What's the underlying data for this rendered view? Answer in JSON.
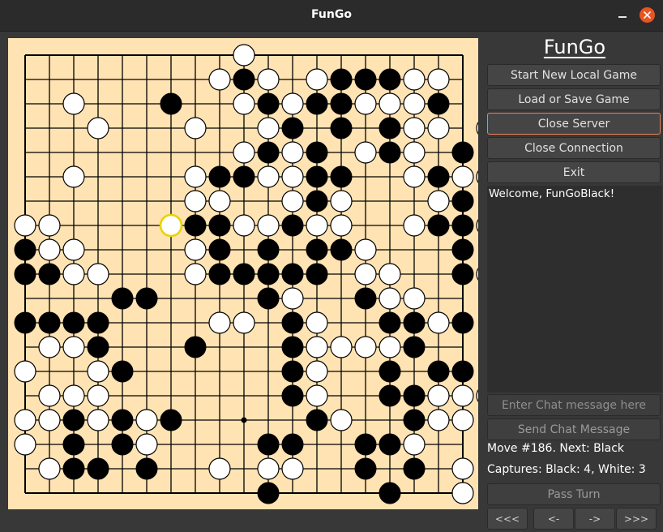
{
  "window": {
    "title": "FunGo"
  },
  "sidebar": {
    "app_title": "FunGo",
    "buttons": {
      "new_local_game": "Start New Local Game",
      "load_save": "Load or Save Game",
      "close_server": "Close Server",
      "close_connection": "Close Connection",
      "exit": "Exit"
    },
    "chat_log": "Welcome, FunGoBlack!",
    "chat_placeholder": "Enter Chat message here",
    "send_chat": "Send Chat Message",
    "move_status": "Move #186. Next: Black",
    "captures": "Captures: Black: 4, White: 3",
    "pass_turn": "Pass Turn",
    "nav": {
      "first": "<<<",
      "prev": "<-",
      "next": "->",
      "last": ">>>"
    }
  },
  "board": {
    "size": 19,
    "colors": {
      "background": "#ffe3b3",
      "line": "#000000",
      "last_move": "#e6d400",
      "black": "#000000",
      "white": "#ffffff"
    },
    "rows": [
      "         W         ",
      "        WBW WBBBWW ",
      "  W   B  WBWBBWWWB ",
      "   W   W  WB B BWW W",
      "         WBWB WBW B",
      "  W    WBBWWBB  WBWWB",
      "       WW  WBW   WB B",
      "WW    *BBWWBWW  WBBW",
      "BWW    WB B BBW   B B",
      "BBWW   WBBBBB WW  BW",
      "    BB    BW  BWW",
      "BBBB    WW BW  BBWB",
      " WWB   B   BWWWWB",
      "W  WB      BW  B BB",
      " WWW       BW  BBWWW",
      "WWBWBWB  .  BW  BWW",
      "W B BW    BB  BBW",
      " WBB B  W WW  B B W",
      "          B    B  W"
    ],
    "last_move": {
      "col": 5,
      "row": 7
    }
  }
}
